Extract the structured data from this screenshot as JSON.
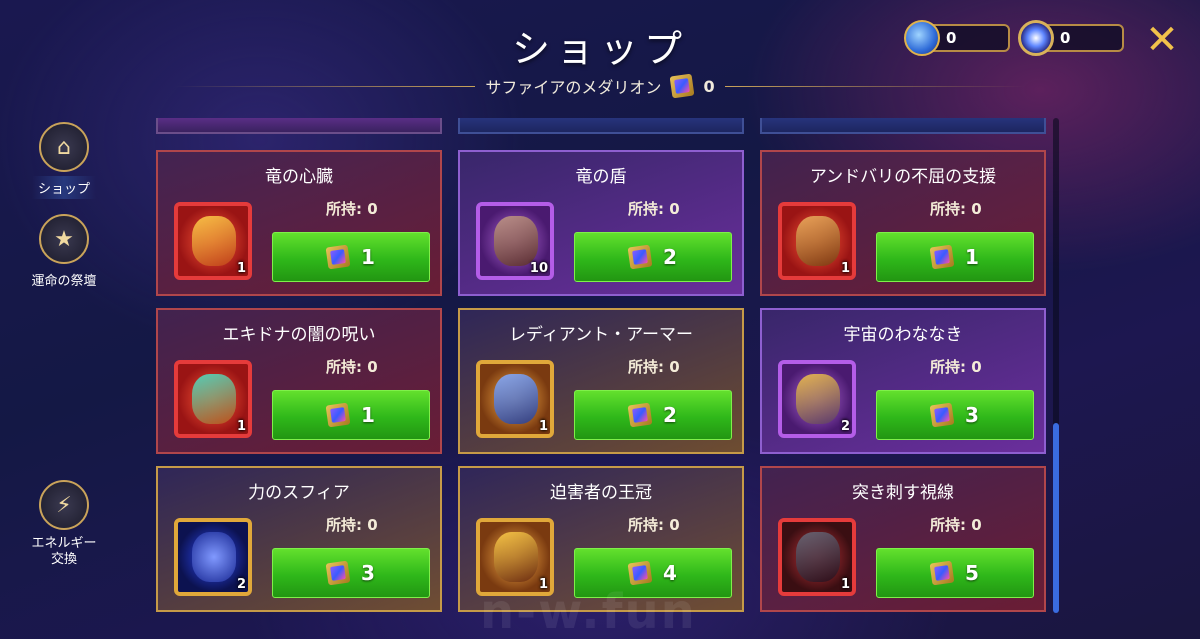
{
  "header": {
    "title": "ショップ",
    "subtitle": "サファイアのメダリオン",
    "medallion_count": "0"
  },
  "currencies": [
    {
      "icon": "energy-crystal-icon",
      "value": "0"
    },
    {
      "icon": "star-emblem-icon",
      "value": "0"
    }
  ],
  "close_icon": "close-icon",
  "sidebar": {
    "items": [
      {
        "label": "ショップ",
        "icon": "shop-icon",
        "active": true
      },
      {
        "label": "運命の祭壇",
        "icon": "star-badge-icon",
        "active": false
      },
      {
        "label": "エネルギー\n交換",
        "icon": "energy-exchange-icon",
        "active": false
      }
    ]
  },
  "items": [
    {
      "name": "竜の心臓",
      "owned_label": "所持:",
      "owned": "0",
      "qty": "1",
      "price": "1",
      "rarity": "red"
    },
    {
      "name": "竜の盾",
      "owned_label": "所持:",
      "owned": "0",
      "qty": "10",
      "price": "2",
      "rarity": "purple"
    },
    {
      "name": "アンドバリの不屈の支援",
      "owned_label": "所持:",
      "owned": "0",
      "qty": "1",
      "price": "1",
      "rarity": "red"
    },
    {
      "name": "エキドナの闇の呪い",
      "owned_label": "所持:",
      "owned": "0",
      "qty": "1",
      "price": "1",
      "rarity": "red"
    },
    {
      "name": "レディアント・アーマー",
      "owned_label": "所持:",
      "owned": "0",
      "qty": "1",
      "price": "2",
      "rarity": "gold"
    },
    {
      "name": "宇宙のわななき",
      "owned_label": "所持:",
      "owned": "0",
      "qty": "2",
      "price": "3",
      "rarity": "purple"
    },
    {
      "name": "力のスフィア",
      "owned_label": "所持:",
      "owned": "0",
      "qty": "2",
      "price": "3",
      "rarity": "gold"
    },
    {
      "name": "迫害者の王冠",
      "owned_label": "所持:",
      "owned": "0",
      "qty": "1",
      "price": "4",
      "rarity": "gold"
    },
    {
      "name": "突き刺す視線",
      "owned_label": "所持:",
      "owned": "0",
      "qty": "1",
      "price": "5",
      "rarity": "red"
    }
  ],
  "watermark": "n-w.fun",
  "colors": {
    "buy_button": "#2fb81a",
    "gold_accent": "#c9a35a",
    "close_icon": "#f2c24b"
  }
}
